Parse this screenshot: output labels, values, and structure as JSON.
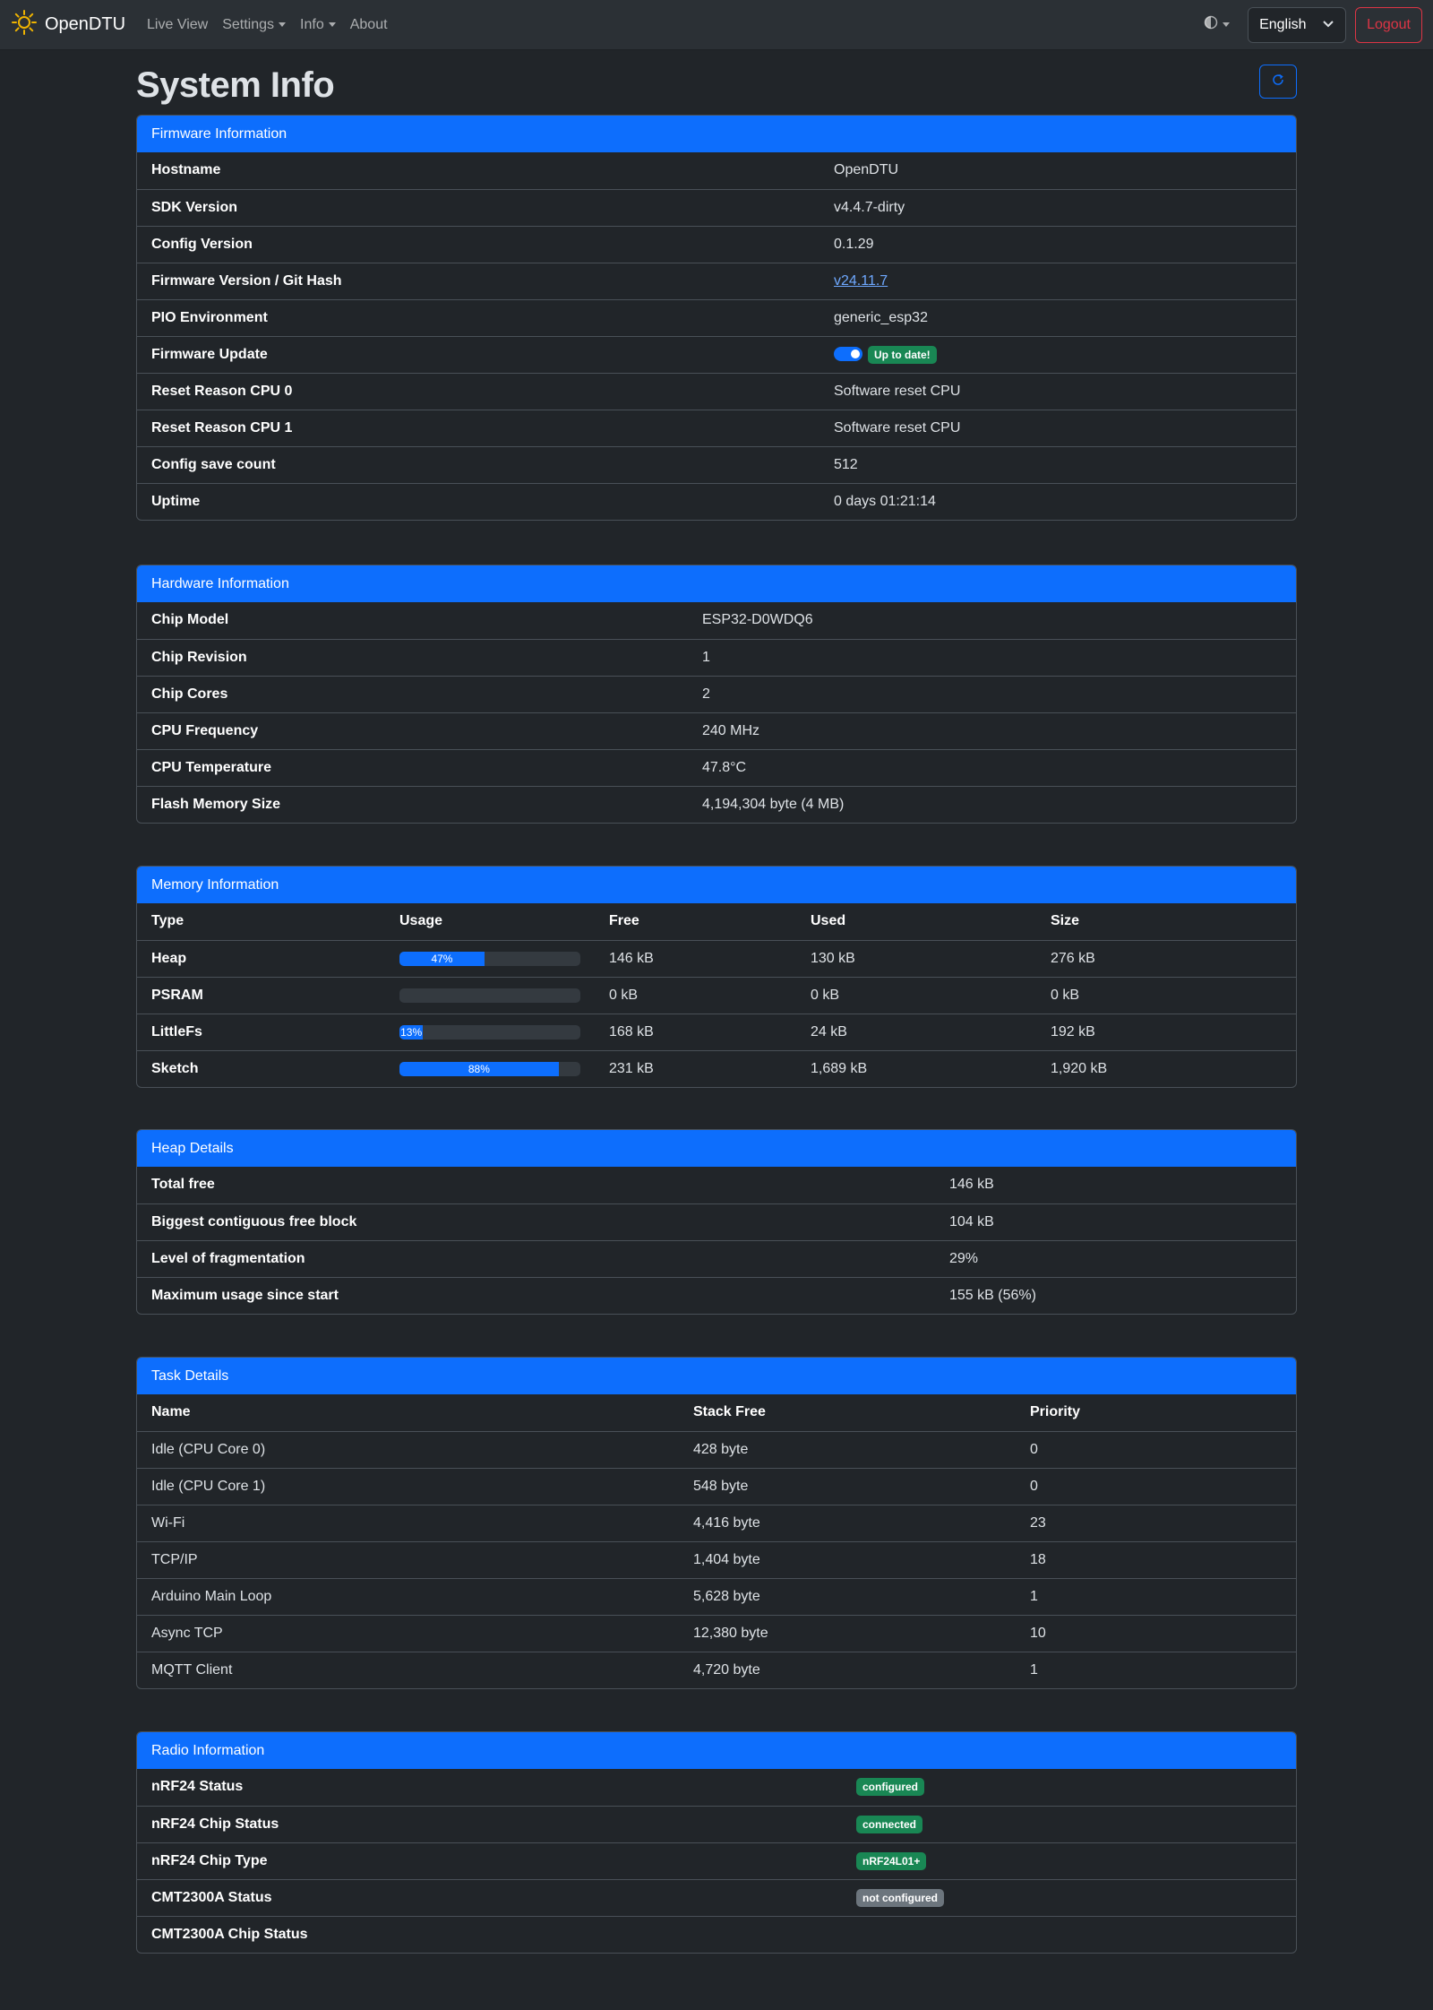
{
  "navbar": {
    "brand": "OpenDTU",
    "links": [
      "Live View",
      "Settings",
      "Info",
      "About"
    ],
    "language": "English",
    "logout": "Logout"
  },
  "page_title": "System Info",
  "firmware": {
    "title": "Firmware Information",
    "rows": [
      {
        "label": "Hostname",
        "value": "OpenDTU"
      },
      {
        "label": "SDK Version",
        "value": "v4.4.7-dirty"
      },
      {
        "label": "Config Version",
        "value": "0.1.29"
      },
      {
        "label": "Firmware Version / Git Hash",
        "value": "v24.11.7"
      },
      {
        "label": "PIO Environment",
        "value": "generic_esp32"
      },
      {
        "label": "Firmware Update",
        "value": "Up to date!"
      },
      {
        "label": "Reset Reason CPU 0",
        "value": "Software reset CPU"
      },
      {
        "label": "Reset Reason CPU 1",
        "value": "Software reset CPU"
      },
      {
        "label": "Config save count",
        "value": "512"
      },
      {
        "label": "Uptime",
        "value": "0 days 01:21:14"
      }
    ]
  },
  "hardware": {
    "title": "Hardware Information",
    "rows": [
      {
        "label": "Chip Model",
        "value": "ESP32-D0WDQ6"
      },
      {
        "label": "Chip Revision",
        "value": "1"
      },
      {
        "label": "Chip Cores",
        "value": "2"
      },
      {
        "label": "CPU Frequency",
        "value": "240 MHz"
      },
      {
        "label": "CPU Temperature",
        "value": "47.8°C"
      },
      {
        "label": "Flash Memory Size",
        "value": "4,194,304 byte (4 MB)"
      }
    ]
  },
  "memory": {
    "title": "Memory Information",
    "headers": [
      "Type",
      "Usage",
      "Free",
      "Used",
      "Size"
    ],
    "rows": [
      {
        "type": "Heap",
        "usage": 47,
        "usage_label": "47%",
        "free": "146 kB",
        "used": "130 kB",
        "size": "276 kB"
      },
      {
        "type": "PSRAM",
        "usage": 0,
        "usage_label": "",
        "free": "0 kB",
        "used": "0 kB",
        "size": "0 kB"
      },
      {
        "type": "LittleFs",
        "usage": 13,
        "usage_label": "13%",
        "free": "168 kB",
        "used": "24 kB",
        "size": "192 kB"
      },
      {
        "type": "Sketch",
        "usage": 88,
        "usage_label": "88%",
        "free": "231 kB",
        "used": "1,689 kB",
        "size": "1,920 kB"
      }
    ]
  },
  "heap": {
    "title": "Heap Details",
    "rows": [
      {
        "label": "Total free",
        "value": "146 kB"
      },
      {
        "label": "Biggest contiguous free block",
        "value": "104 kB"
      },
      {
        "label": "Level of fragmentation",
        "value": "29%"
      },
      {
        "label": "Maximum usage since start",
        "value": "155 kB (56%)"
      }
    ]
  },
  "tasks": {
    "title": "Task Details",
    "headers": [
      "Name",
      "Stack Free",
      "Priority"
    ],
    "rows": [
      {
        "name": "Idle (CPU Core 0)",
        "stack": "428 byte",
        "priority": "0"
      },
      {
        "name": "Idle (CPU Core 1)",
        "stack": "548 byte",
        "priority": "0"
      },
      {
        "name": "Wi-Fi",
        "stack": "4,416 byte",
        "priority": "23"
      },
      {
        "name": "TCP/IP",
        "stack": "1,404 byte",
        "priority": "18"
      },
      {
        "name": "Arduino Main Loop",
        "stack": "5,628 byte",
        "priority": "1"
      },
      {
        "name": "Async TCP",
        "stack": "12,380 byte",
        "priority": "10"
      },
      {
        "name": "MQTT Client",
        "stack": "4,720 byte",
        "priority": "1"
      }
    ]
  },
  "radio": {
    "title": "Radio Information",
    "rows": [
      {
        "label": "nRF24 Status",
        "value": "configured",
        "color": "#198754"
      },
      {
        "label": "nRF24 Chip Status",
        "value": "connected",
        "color": "#198754"
      },
      {
        "label": "nRF24 Chip Type",
        "value": "nRF24L01+",
        "color": "#198754"
      },
      {
        "label": "CMT2300A Status",
        "value": "not configured",
        "color": "#6c757d"
      },
      {
        "label": "CMT2300A Chip Status",
        "value": "",
        "color": ""
      }
    ]
  }
}
